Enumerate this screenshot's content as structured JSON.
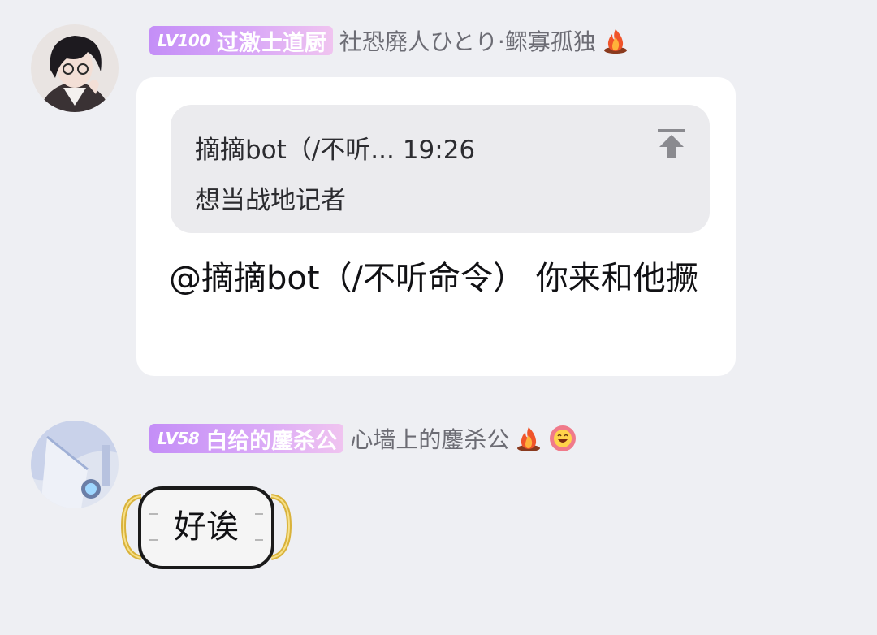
{
  "messages": [
    {
      "level": "LV100",
      "title": "过激士道厨",
      "nickname": "社恐廃人ひとり·鳏寡孤独",
      "quote": {
        "sender": "摘摘bot（/不听...",
        "time": "19:26",
        "text": "想当战地记者"
      },
      "text": "@摘摘bot（/不听命令） 你来和他撅",
      "icons": [
        "fire-icon"
      ]
    },
    {
      "level": "LV58",
      "title": "白给的鏖杀公",
      "nickname": "心墙上的鏖杀公",
      "text": "好诶",
      "icons": [
        "fire-icon",
        "grin-face-icon"
      ]
    }
  ],
  "colors": {
    "background": "#eeeff3",
    "badge": "#c48ef7",
    "bubble": "#ffffff",
    "quote": "#ebebee",
    "nickname": "#6c6c74"
  }
}
